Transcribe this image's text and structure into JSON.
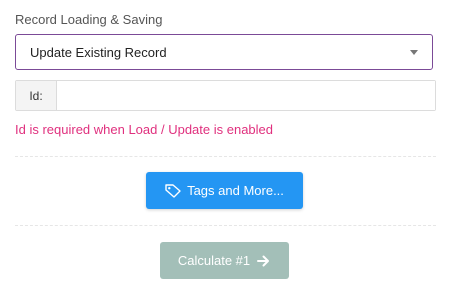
{
  "section": {
    "label": "Record Loading & Saving"
  },
  "record_mode": {
    "selected": "Update Existing Record"
  },
  "id_field": {
    "addon_label": "Id:",
    "value": ""
  },
  "validation": {
    "error": "Id is required when Load / Update is enabled"
  },
  "buttons": {
    "tags_label": "Tags and More...",
    "tags_icon": "tag-icon",
    "calculate_label": "Calculate #1",
    "calculate_icon": "arrow-right-icon"
  },
  "colors": {
    "accent": "#2496f3",
    "select_border": "#7b4a97",
    "error": "#e0307e",
    "calculate_disabled": "#a3bfb8"
  }
}
